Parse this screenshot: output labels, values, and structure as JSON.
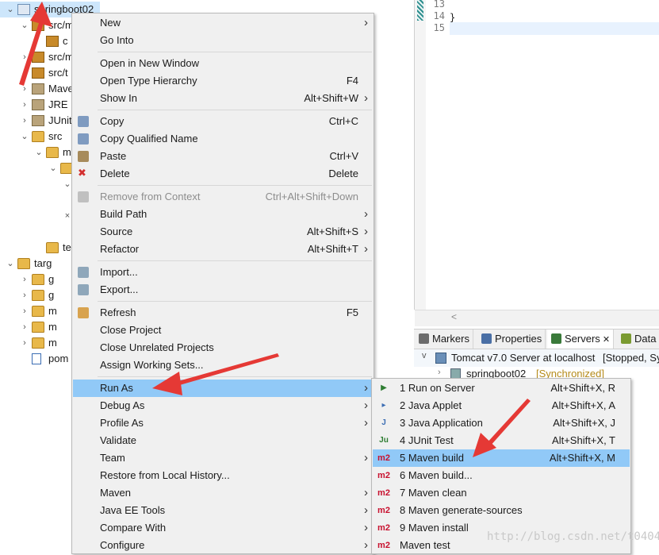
{
  "explorer": {
    "rows": [
      {
        "label": "springboot02",
        "indent": 0,
        "twisty": "v",
        "icon": "project",
        "selected": true
      },
      {
        "label": "src/m",
        "indent": 1,
        "twisty": "v",
        "icon": "package-folder"
      },
      {
        "label": "c",
        "indent": 2,
        "twisty": "",
        "icon": "package"
      },
      {
        "label": "src/m",
        "indent": 1,
        "twisty": ">",
        "icon": "package-folder"
      },
      {
        "label": "src/t",
        "indent": 1,
        "twisty": ">",
        "icon": "package-folder"
      },
      {
        "label": "Mave",
        "indent": 1,
        "twisty": ">",
        "icon": "library"
      },
      {
        "label": "JRE",
        "indent": 1,
        "twisty": ">",
        "icon": "library"
      },
      {
        "label": "JUnit",
        "indent": 1,
        "twisty": ">",
        "icon": "library"
      },
      {
        "label": "src",
        "indent": 1,
        "twisty": "v",
        "icon": "folder"
      },
      {
        "label": "m",
        "indent": 2,
        "twisty": "v",
        "icon": "folder"
      },
      {
        "label": "",
        "indent": 3,
        "twisty": "v",
        "icon": "folder"
      },
      {
        "label": "",
        "indent": 4,
        "twisty": "v",
        "icon": ""
      },
      {
        "label": "",
        "indent": 4,
        "twisty": "",
        "icon": ""
      },
      {
        "label": "",
        "indent": 4,
        "twisty": "x",
        "icon": ""
      },
      {
        "label": "",
        "indent": 4,
        "twisty": "",
        "icon": ""
      },
      {
        "label": "te",
        "indent": 2,
        "twisty": "",
        "icon": "folder"
      },
      {
        "label": "targ",
        "indent": 0,
        "twisty": "v",
        "icon": "folder"
      },
      {
        "label": "g",
        "indent": 1,
        "twisty": ">",
        "icon": "folder"
      },
      {
        "label": "g",
        "indent": 1,
        "twisty": ">",
        "icon": "folder"
      },
      {
        "label": "m",
        "indent": 1,
        "twisty": ">",
        "icon": "folder"
      },
      {
        "label": "m",
        "indent": 1,
        "twisty": ">",
        "icon": "folder"
      },
      {
        "label": "m",
        "indent": 1,
        "twisty": ">",
        "icon": "folder"
      },
      {
        "label": "pom",
        "indent": 1,
        "twisty": "",
        "icon": "maven-file"
      }
    ]
  },
  "editor": {
    "lines": [
      {
        "num": "13",
        "code": ""
      },
      {
        "num": "14",
        "code": "}"
      },
      {
        "num": "15",
        "code": ""
      }
    ],
    "scroll_indicator": "<"
  },
  "views": {
    "tabs": [
      {
        "label": "Markers",
        "icon": "markers-icon",
        "active": false,
        "color": "#6b6b6b"
      },
      {
        "label": "Properties",
        "icon": "properties-icon",
        "active": false,
        "color": "#4a6fa5"
      },
      {
        "label": "Servers",
        "icon": "servers-icon",
        "active": true,
        "color": "#3a7a3a",
        "close": "✕"
      },
      {
        "label": "Data",
        "icon": "data-source-icon",
        "active": false,
        "color": "#7a9a30"
      }
    ],
    "server": "Tomcat v7.0 Server at localhost",
    "server_state": "[Stopped, Sy",
    "module": "springboot02",
    "module_state": "[Synchronized]"
  },
  "context_menu": {
    "items": [
      {
        "type": "item",
        "label": "New",
        "arrow": true
      },
      {
        "type": "item",
        "label": "Go Into"
      },
      {
        "type": "sep"
      },
      {
        "type": "item",
        "label": "Open in New Window"
      },
      {
        "type": "item",
        "label": "Open Type Hierarchy",
        "shortcut": "F4"
      },
      {
        "type": "item",
        "label": "Show In",
        "shortcut": "Alt+Shift+W",
        "arrow": true
      },
      {
        "type": "sep"
      },
      {
        "type": "item",
        "label": "Copy",
        "shortcut": "Ctrl+C",
        "icon": "copy-icon"
      },
      {
        "type": "item",
        "label": "Copy Qualified Name",
        "icon": "copy-qualified-name-icon"
      },
      {
        "type": "item",
        "label": "Paste",
        "shortcut": "Ctrl+V",
        "icon": "paste-icon"
      },
      {
        "type": "item",
        "label": "Delete",
        "shortcut": "Delete",
        "icon": "delete-icon"
      },
      {
        "type": "sep"
      },
      {
        "type": "item",
        "label": "Remove from Context",
        "shortcut": "Ctrl+Alt+Shift+Down",
        "disabled": true,
        "icon": "remove-context-icon"
      },
      {
        "type": "item",
        "label": "Build Path",
        "arrow": true
      },
      {
        "type": "item",
        "label": "Source",
        "shortcut": "Alt+Shift+S",
        "arrow": true
      },
      {
        "type": "item",
        "label": "Refactor",
        "shortcut": "Alt+Shift+T",
        "arrow": true
      },
      {
        "type": "sep"
      },
      {
        "type": "item",
        "label": "Import...",
        "icon": "import-icon"
      },
      {
        "type": "item",
        "label": "Export...",
        "icon": "export-icon"
      },
      {
        "type": "sep"
      },
      {
        "type": "item",
        "label": "Refresh",
        "shortcut": "F5",
        "icon": "refresh-icon"
      },
      {
        "type": "item",
        "label": "Close Project"
      },
      {
        "type": "item",
        "label": "Close Unrelated Projects"
      },
      {
        "type": "item",
        "label": "Assign Working Sets..."
      },
      {
        "type": "sep"
      },
      {
        "type": "item",
        "label": "Run As",
        "arrow": true,
        "highlight": true
      },
      {
        "type": "item",
        "label": "Debug As",
        "arrow": true
      },
      {
        "type": "item",
        "label": "Profile As",
        "arrow": true
      },
      {
        "type": "item",
        "label": "Validate"
      },
      {
        "type": "item",
        "label": "Team",
        "arrow": true
      },
      {
        "type": "item",
        "label": "Restore from Local History..."
      },
      {
        "type": "item",
        "label": "Maven",
        "arrow": true
      },
      {
        "type": "item",
        "label": "Java EE Tools",
        "arrow": true
      },
      {
        "type": "item",
        "label": "Compare With",
        "arrow": true
      },
      {
        "type": "item",
        "label": "Configure",
        "arrow": true
      }
    ]
  },
  "run_as_submenu": {
    "items": [
      {
        "label": "1 Run on Server",
        "shortcut": "Alt+Shift+X, R",
        "icon": "run-on-server-icon",
        "glyph": "▶",
        "color": "#2e7d32"
      },
      {
        "label": "2 Java Applet",
        "shortcut": "Alt+Shift+X, A",
        "icon": "java-applet-icon",
        "glyph": "▸",
        "color": "#3b6db3"
      },
      {
        "label": "3 Java Application",
        "shortcut": "Alt+Shift+X, J",
        "icon": "java-application-icon",
        "glyph": "J",
        "color": "#3b6db3"
      },
      {
        "label": "4 JUnit Test",
        "shortcut": "Alt+Shift+X, T",
        "icon": "junit-icon",
        "glyph": "Ju",
        "color": "#2e7d32"
      },
      {
        "label": "5 Maven build",
        "shortcut": "Alt+Shift+X, M",
        "icon": "maven-m2-icon",
        "glyph": "m2",
        "color": "#c8102e",
        "highlight": true
      },
      {
        "label": "6 Maven build...",
        "icon": "maven-m2-icon",
        "glyph": "m2",
        "color": "#c8102e"
      },
      {
        "label": "7 Maven clean",
        "icon": "maven-m2-icon",
        "glyph": "m2",
        "color": "#c8102e"
      },
      {
        "label": "8 Maven generate-sources",
        "icon": "maven-m2-icon",
        "glyph": "m2",
        "color": "#c8102e"
      },
      {
        "label": "9 Maven install",
        "icon": "maven-m2-icon",
        "glyph": "m2",
        "color": "#c8102e"
      },
      {
        "label": "Maven test",
        "icon": "maven-m2-icon",
        "glyph": "m2",
        "color": "#c8102e"
      }
    ]
  },
  "watermark": "http://blog.csdn.net/t0404",
  "colors": {
    "arrow": "#e53935",
    "highlight": "#91c9f7",
    "selection": "#cde6fb"
  }
}
